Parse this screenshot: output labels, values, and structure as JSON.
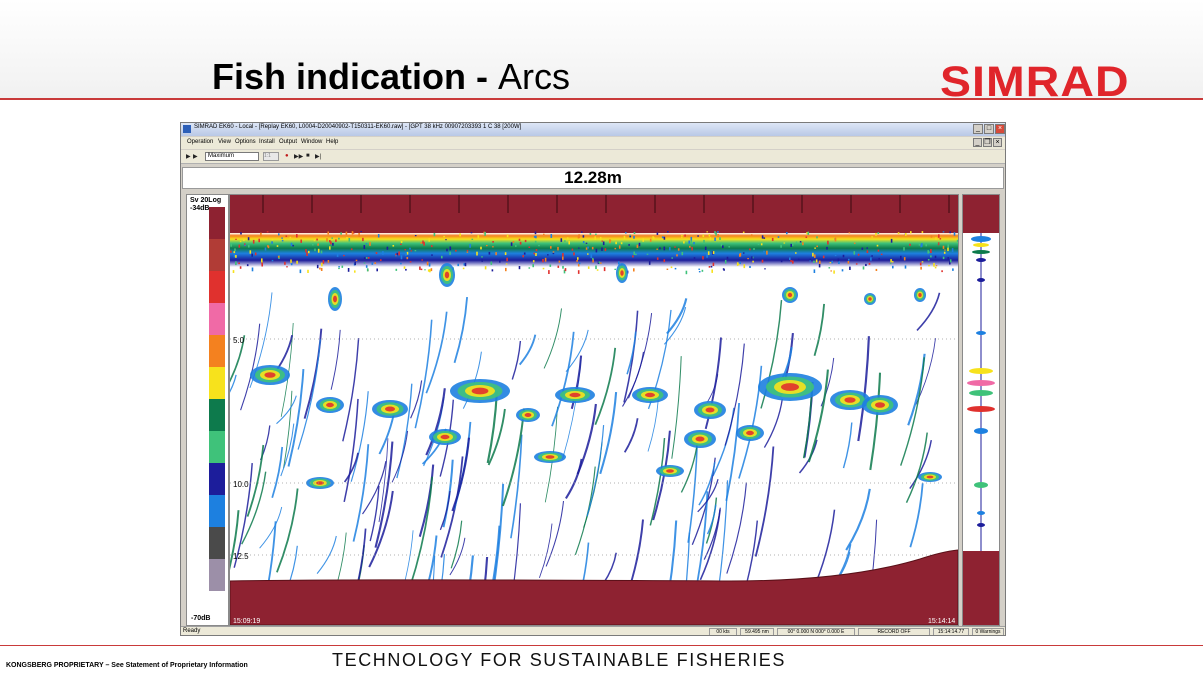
{
  "slide": {
    "title_bold": "Fish indication - ",
    "title_regular": "Arcs",
    "brand": "SIMRAD",
    "footer_left": "KONGSBERG PROPRIETARY – See Statement of Proprietary Information",
    "footer_center": "TECHNOLOGY FOR SUSTAINABLE FISHERIES",
    "accent_color": "#c93a3a",
    "brand_color": "#e0252b"
  },
  "window": {
    "title": "SIMRAD EK60 - Local - [Replay EK60, L0004-D20040902-T150311-EK60.raw] - [GPT 38 kHz 00907203393 1 C 38 [200W]",
    "minimize_label": "_",
    "maximize_label": "□",
    "close_label": "×",
    "inner_minimize_label": "_",
    "inner_restore_label": "❐",
    "inner_close_label": "×"
  },
  "menu": {
    "items": [
      "Operation",
      "View",
      "Options",
      "Install",
      "Output",
      "Window",
      "Help"
    ]
  },
  "toolbar": {
    "play_glyph": "▶",
    "step_glyph": "▶|",
    "forward_glyph": "▶",
    "mode_select_value": "Maximum",
    "speed_value": "1:1",
    "record_glyph": "●",
    "ff_glyph": "▶▶",
    "stop_glyph": "■",
    "next_glyph": "▶|"
  },
  "echogram": {
    "depth_readout": "12.28m",
    "depth_labels": [
      "5.0",
      "10.0",
      "12.5"
    ],
    "time_start": "15:09:19",
    "time_end": "15:14:14"
  },
  "color_scale": {
    "title_line1": "Sv 20Log",
    "title_line2": "-34dB",
    "min_label": "-70dB",
    "colors": [
      "#8e2231",
      "#b13c36",
      "#e0312e",
      "#f06aa6",
      "#f4811f",
      "#f7e21c",
      "#0d7a4c",
      "#3fc27a",
      "#1c1d9b",
      "#1d80e0",
      "#4a4a4a",
      "#9c8fa8",
      "#ffffff"
    ]
  },
  "status": {
    "ready": "Ready",
    "cells": [
      "00 kts",
      "59.495 nm",
      "00° 0.000 N 000° 0.000 E",
      "RECORD OFF",
      "15:14:14.77",
      "0 Warnings"
    ]
  }
}
